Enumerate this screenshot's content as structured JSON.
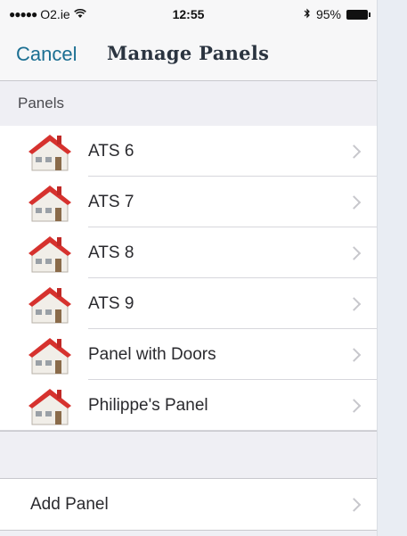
{
  "status": {
    "carrier": "O2.ie",
    "time": "12:55",
    "battery": "95%"
  },
  "nav": {
    "cancel_label": "Cancel",
    "title": "Manage Panels"
  },
  "panels_section": {
    "header": "Panels",
    "items": [
      {
        "label": "ATS 6",
        "icon": "house-icon"
      },
      {
        "label": "ATS 7",
        "icon": "house-icon"
      },
      {
        "label": "ATS 8",
        "icon": "house-icon"
      },
      {
        "label": "ATS 9",
        "icon": "house-icon"
      },
      {
        "label": "Panel with Doors",
        "icon": "house-icon"
      },
      {
        "label": "Philippe's Panel",
        "icon": "house-icon"
      }
    ]
  },
  "add_panel": {
    "label": "Add Panel"
  },
  "colors": {
    "accent": "#1b6f92",
    "roof": "#d6322e"
  }
}
